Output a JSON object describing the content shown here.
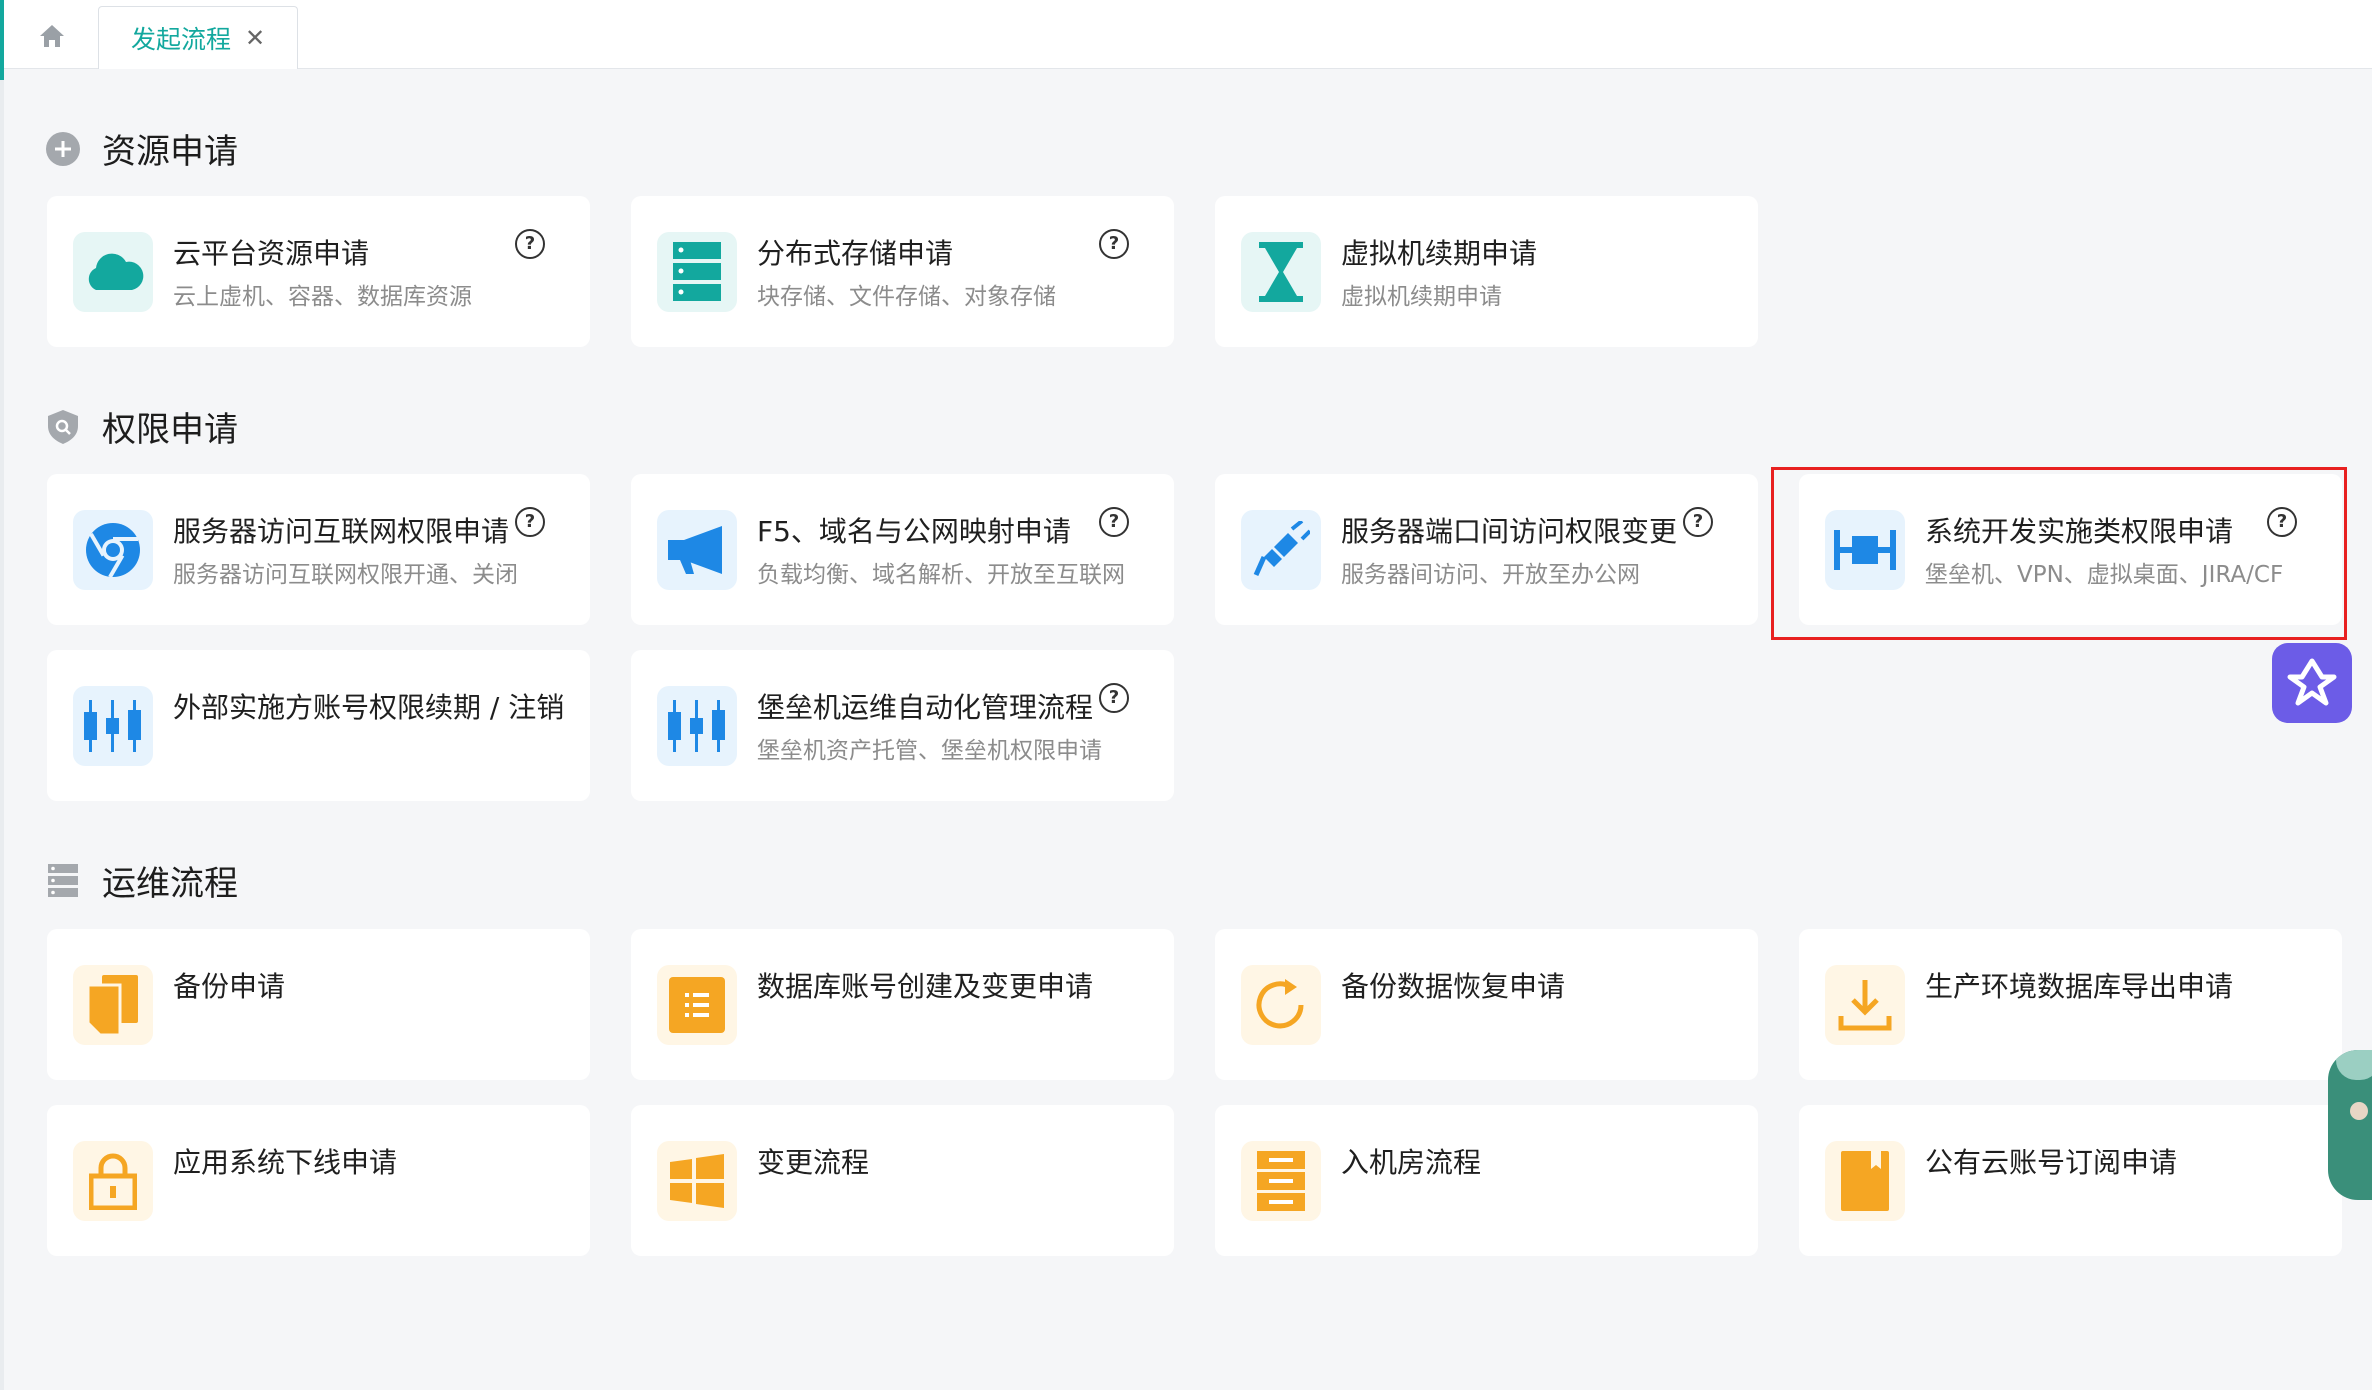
{
  "tabs": {
    "active_label": "发起流程",
    "close_glyph": "✕"
  },
  "sections": [
    {
      "title": "资源申请",
      "icon": "plus-circle-icon",
      "cards": [
        {
          "title": "云平台资源申请",
          "subtitle": "云上虚机、容器、数据库资源",
          "icon": "cloud-icon",
          "help": "?"
        },
        {
          "title": "分布式存储申请",
          "subtitle": "块存储、文件存储、对象存储",
          "icon": "server-stack-icon",
          "help": "?"
        },
        {
          "title": "虚拟机续期申请",
          "subtitle": "虚拟机续期申请",
          "icon": "hourglass-icon"
        }
      ]
    },
    {
      "title": "权限申请",
      "icon": "shield-icon",
      "cards": [
        {
          "title": "服务器访问互联网权限申请",
          "subtitle": "服务器访问互联网权限开通、关闭",
          "icon": "browser-icon",
          "help": "?"
        },
        {
          "title": "F5、域名与公网映射申请",
          "subtitle": "负载均衡、域名解析、开放至互联网",
          "icon": "megaphone-icon",
          "help": "?"
        },
        {
          "title": "服务器端口间访问权限变更",
          "subtitle": "服务器间访问、开放至办公网",
          "icon": "plug-icon",
          "help": "?"
        },
        {
          "title": "系统开发实施类权限申请",
          "subtitle": "堡垒机、VPN、虚拟桌面、JIRA/CF",
          "icon": "dev-bar-icon",
          "help": "?"
        },
        {
          "title": "外部实施方账号权限续期 / 注销",
          "subtitle": "",
          "icon": "candlestick-icon"
        },
        {
          "title": "堡垒机运维自动化管理流程",
          "subtitle": "堡垒机资产托管、堡垒机权限申请",
          "icon": "candlestick-icon",
          "help": "?"
        }
      ]
    },
    {
      "title": "运维流程",
      "icon": "server-list-icon",
      "cards": [
        {
          "title": "备份申请",
          "subtitle": "",
          "icon": "copy-icon"
        },
        {
          "title": "数据库账号创建及变更申请",
          "subtitle": "",
          "icon": "list-icon"
        },
        {
          "title": "备份数据恢复申请",
          "subtitle": "",
          "icon": "refresh-icon"
        },
        {
          "title": "生产环境数据库导出申请",
          "subtitle": "",
          "icon": "download-icon"
        },
        {
          "title": "应用系统下线申请",
          "subtitle": "",
          "icon": "lock-icon"
        },
        {
          "title": "变更流程",
          "subtitle": "",
          "icon": "windows-icon"
        },
        {
          "title": "入机房流程",
          "subtitle": "",
          "icon": "cabinet-icon"
        },
        {
          "title": "公有云账号订阅申请",
          "subtitle": "",
          "icon": "book-icon"
        }
      ]
    }
  ],
  "colors": {
    "teal": "#13a89e",
    "blue": "#1e88e5",
    "orange": "#f5a623",
    "highlight": "#e82020",
    "assistant": "#6c5ce7"
  }
}
